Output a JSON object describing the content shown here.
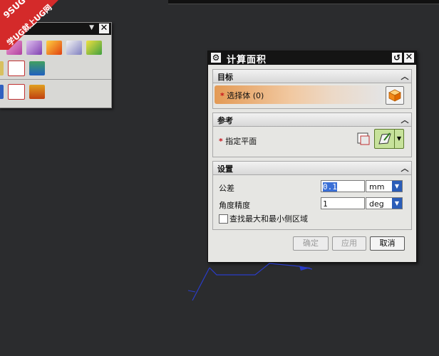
{
  "watermark": {
    "line1": "9SUG",
    "line2": "学UG就上UG网"
  },
  "dialog": {
    "title": "计算面积",
    "sections": {
      "target": {
        "header": "目标",
        "select_label": "选择体 (0)"
      },
      "reference": {
        "header": "参考",
        "plane_label": "指定平面"
      },
      "settings": {
        "header": "设置",
        "tolerance_label": "公差",
        "tolerance_value": "0.1",
        "tolerance_unit": "mm",
        "angle_label": "角度精度",
        "angle_value": "1",
        "angle_unit": "deg",
        "checkbox_label": "查找最大和最小侧区域"
      }
    },
    "buttons": {
      "ok": "确定",
      "apply": "应用",
      "cancel": "取消"
    }
  },
  "colors": {
    "background": "#2b2c2e",
    "accent_orange": "#e39a55",
    "select_green": "#c7e29b",
    "required_star": "#c8141b"
  },
  "icons": [
    "gear-icon",
    "reset-icon",
    "close-icon",
    "chevron-up-icon",
    "cube-icon",
    "plane-icon",
    "dropdown-arrow-icon"
  ]
}
